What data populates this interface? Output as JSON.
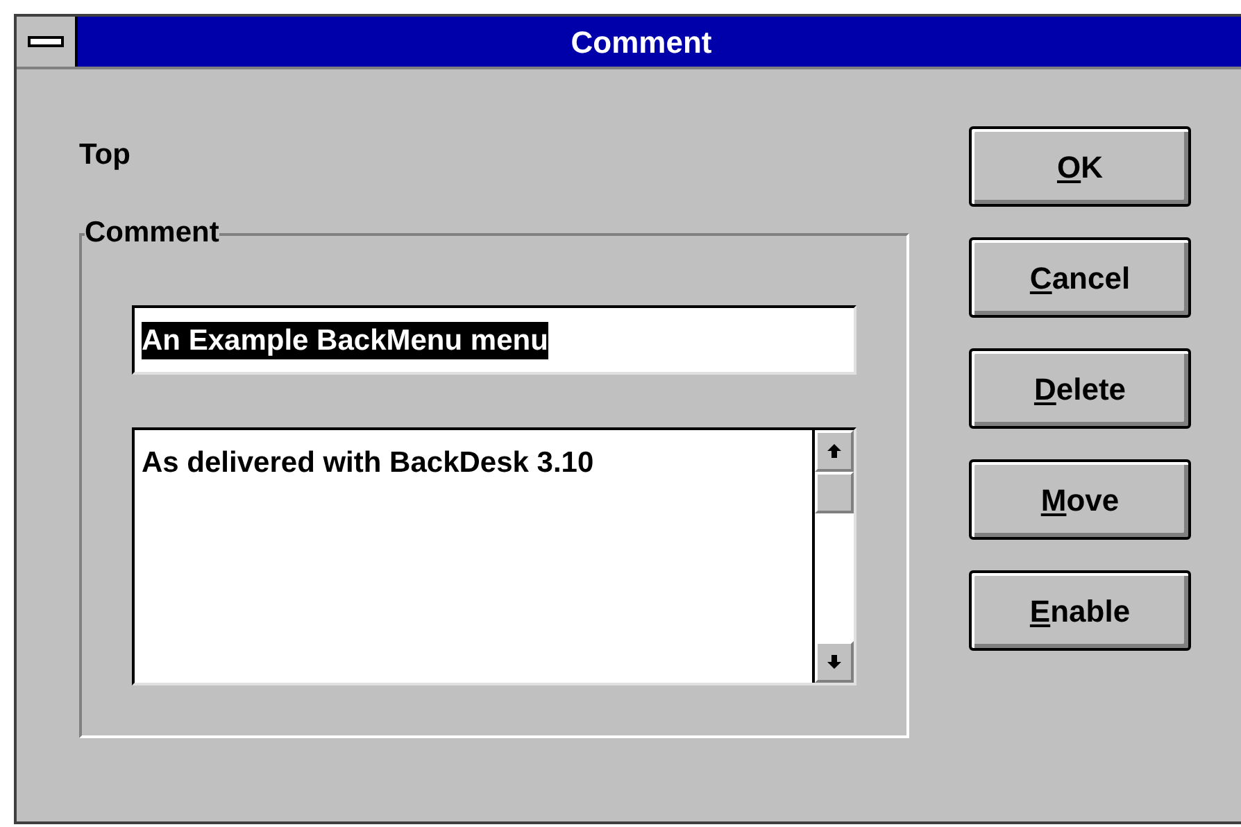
{
  "window": {
    "title": "Comment"
  },
  "location_label": "Top",
  "group": {
    "label": "Comment",
    "name_field": {
      "value": "An Example BackMenu menu",
      "selected": true
    },
    "notes_field": {
      "value": "As delivered with BackDesk 3.10"
    }
  },
  "buttons": [
    {
      "label": "OK"
    },
    {
      "label": "Cancel"
    },
    {
      "label": "Delete"
    },
    {
      "label": "Move"
    },
    {
      "label": "Enable"
    }
  ]
}
